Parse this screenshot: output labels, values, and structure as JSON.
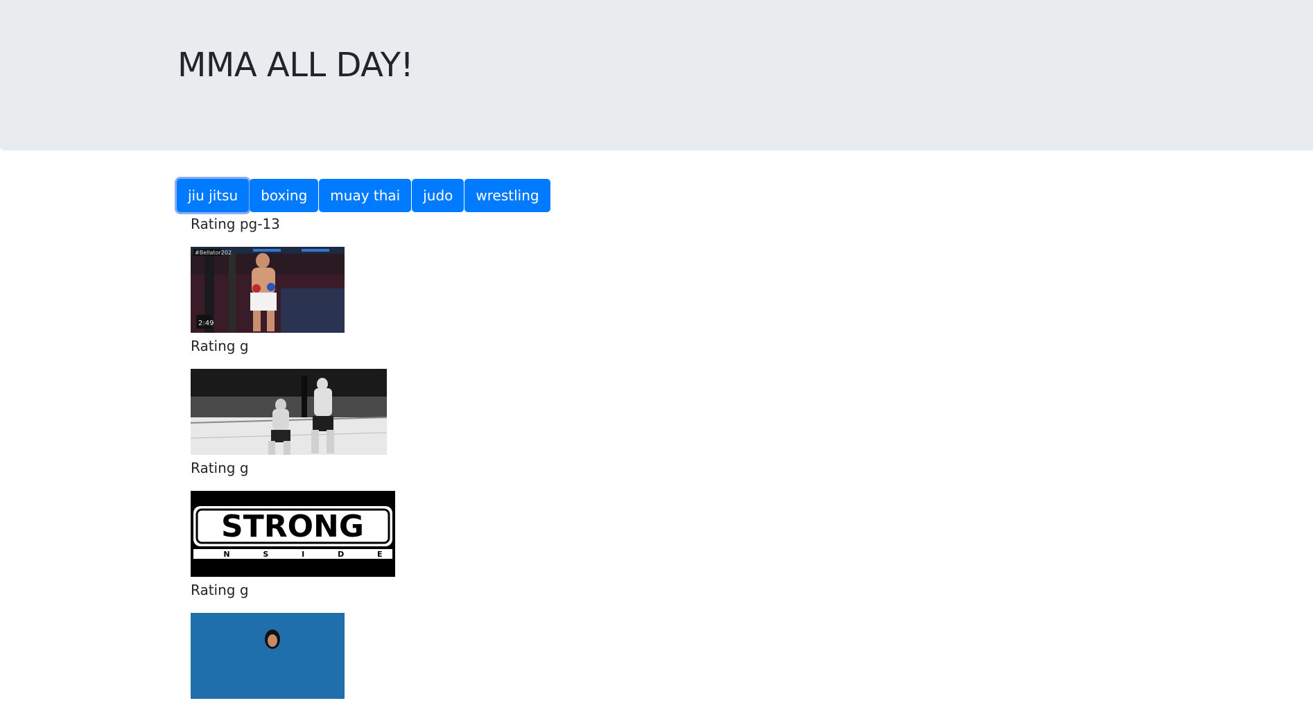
{
  "header": {
    "title": "MMA ALL DAY!"
  },
  "categories": [
    {
      "label": "jiu jitsu",
      "active": true
    },
    {
      "label": "boxing",
      "active": false
    },
    {
      "label": "muay thai",
      "active": false
    },
    {
      "label": "judo",
      "active": false
    },
    {
      "label": "wrestling",
      "active": false
    }
  ],
  "results": [
    {
      "rating": "Rating pg-13",
      "image": "fighter-in-cage-gif"
    },
    {
      "rating": "Rating g",
      "image": "fighters-boxing-bw-gif"
    },
    {
      "rating": "Rating g",
      "image": "strong-inside-logo-gif"
    },
    {
      "rating": "Rating g",
      "image": "person-blue-background-gif"
    }
  ],
  "image_texts": {
    "strong_logo_main": "STRONG",
    "strong_logo_sub": "I N S I D E"
  },
  "colors": {
    "primary_button": "#007bff",
    "jumbotron_bg": "#e9ecef",
    "text": "#212529"
  }
}
